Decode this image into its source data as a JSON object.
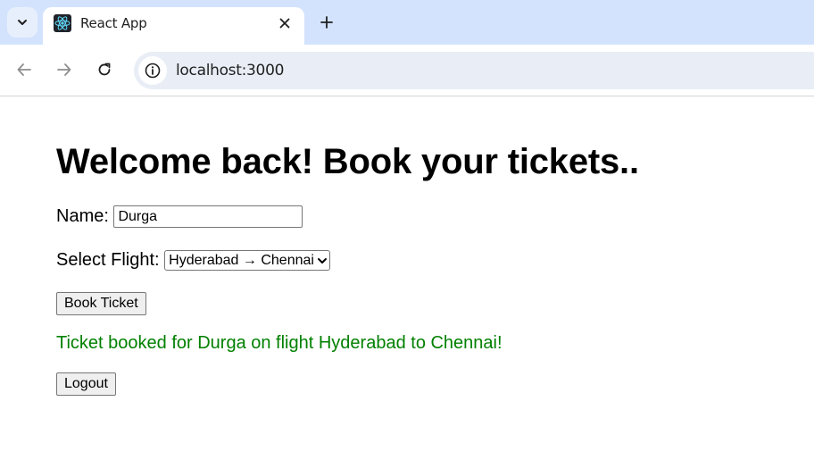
{
  "browser": {
    "tab_title": "React App",
    "url": "localhost:3000",
    "icons": {
      "tab_search": "chevron-down-icon",
      "favicon": "react-logo-icon",
      "close": "close-icon",
      "new_tab": "plus-icon",
      "back": "arrow-left-icon",
      "forward": "arrow-right-icon",
      "reload": "reload-icon",
      "site_info": "info-icon"
    }
  },
  "page": {
    "heading": "Welcome back! Book your tickets..",
    "name_label": "Name:",
    "name_value": "Durga",
    "flight_label": "Select Flight:",
    "flight_selected": "Hyderabad → Chennai",
    "book_button": "Book Ticket",
    "success_message": "Ticket booked for Durga on flight Hyderabad to Chennai!",
    "logout_button": "Logout"
  },
  "colors": {
    "tabstrip": "#d3e3fd",
    "omnibox": "#e9eef6",
    "success": "#008000"
  }
}
